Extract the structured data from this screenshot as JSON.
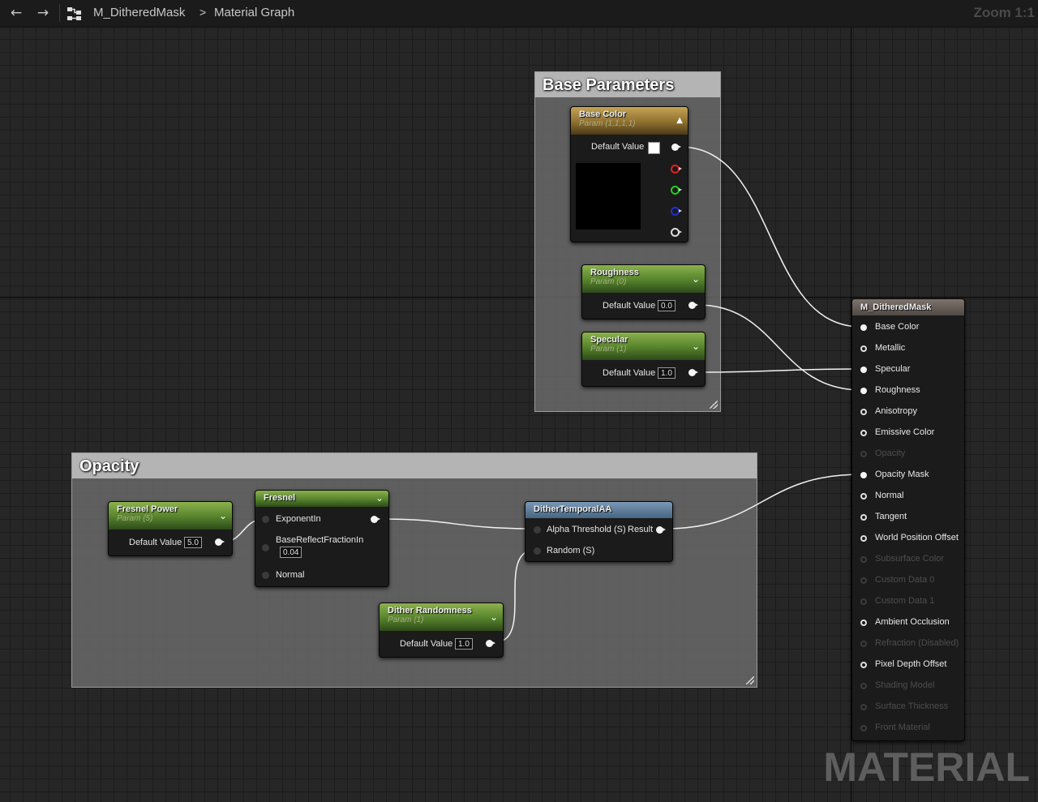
{
  "toolbar": {
    "back_icon": "arrow-left-icon",
    "forward_icon": "arrow-right-icon",
    "graph_icon": "graph-nodes-icon",
    "asset_name": "M_DitheredMask",
    "separator": ">",
    "graph_name": "Material Graph",
    "zoom_label": "Zoom 1:1"
  },
  "comments": {
    "base_parameters": "Base Parameters",
    "opacity": "Opacity"
  },
  "nodes": {
    "base_color": {
      "title": "Base Color",
      "subtitle": "Param (1,1,1,1)",
      "default_label": "Default Value",
      "swatch_color": "#ffffff",
      "preview_color": "#000000",
      "collapse_icon": "chevron-up-icon"
    },
    "roughness": {
      "title": "Roughness",
      "subtitle": "Param (0)",
      "default_label": "Default Value",
      "value": "0.0"
    },
    "specular": {
      "title": "Specular",
      "subtitle": "Param (1)",
      "default_label": "Default Value",
      "value": "1.0"
    },
    "fresnel_power": {
      "title": "Fresnel Power",
      "subtitle": "Param (5)",
      "default_label": "Default Value",
      "value": "5.0"
    },
    "fresnel": {
      "title": "Fresnel",
      "inputs": [
        "ExponentIn",
        "BaseReflectFractionIn",
        "Normal"
      ],
      "base_reflect_value": "0.04"
    },
    "dither": {
      "title": "DitherTemporalAA",
      "inputs": [
        "Alpha Threshold (S)",
        "Random (S)"
      ],
      "output": "Result"
    },
    "dither_randomness": {
      "title": "Dither Randomness",
      "subtitle": "Param (1)",
      "default_label": "Default Value",
      "value": "1.0"
    }
  },
  "result_node": {
    "title": "M_DitheredMask",
    "pins": [
      {
        "label": "Base Color",
        "state": "connected"
      },
      {
        "label": "Metallic",
        "state": "active"
      },
      {
        "label": "Specular",
        "state": "connected"
      },
      {
        "label": "Roughness",
        "state": "connected"
      },
      {
        "label": "Anisotropy",
        "state": "active"
      },
      {
        "label": "Emissive Color",
        "state": "active"
      },
      {
        "label": "Opacity",
        "state": "disabled"
      },
      {
        "label": "Opacity Mask",
        "state": "connected"
      },
      {
        "label": "Normal",
        "state": "active"
      },
      {
        "label": "Tangent",
        "state": "active"
      },
      {
        "label": "World Position Offset",
        "state": "active"
      },
      {
        "label": "Subsurface Color",
        "state": "disabled"
      },
      {
        "label": "Custom Data 0",
        "state": "disabled"
      },
      {
        "label": "Custom Data 1",
        "state": "disabled"
      },
      {
        "label": "Ambient Occlusion",
        "state": "active"
      },
      {
        "label": "Refraction (Disabled)",
        "state": "disabled"
      },
      {
        "label": "Pixel Depth Offset",
        "state": "active"
      },
      {
        "label": "Shading Model",
        "state": "disabled"
      },
      {
        "label": "Surface Thickness",
        "state": "disabled"
      },
      {
        "label": "Front Material",
        "state": "disabled"
      }
    ]
  },
  "watermark": "MATERIAL"
}
